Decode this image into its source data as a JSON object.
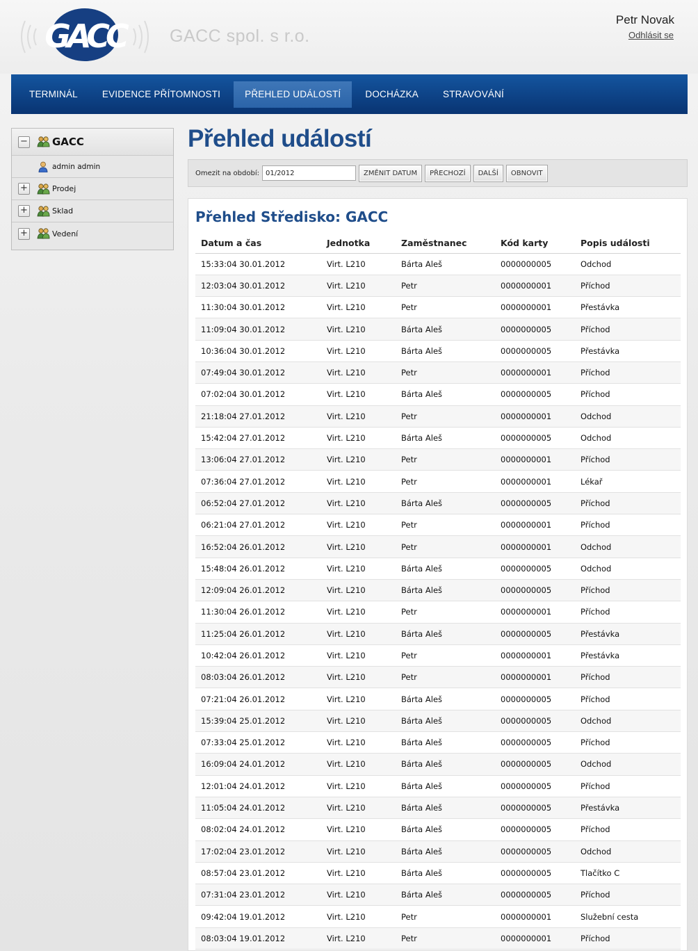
{
  "header": {
    "logo_text": "GACC",
    "company_name": "GACC spol. s r.o.",
    "user_name": "Petr Novak",
    "logout_label": "Odhlásit se"
  },
  "nav": {
    "items": [
      {
        "label": "TERMINÁL"
      },
      {
        "label": "EVIDENCE PŘÍTOMNOSTI"
      },
      {
        "label": "PŘEHLED UDÁLOSTÍ"
      },
      {
        "label": "DOCHÁZKA"
      },
      {
        "label": "STRAVOVÁNÍ"
      }
    ],
    "active_index": 2
  },
  "sidebar": {
    "root": {
      "label": "GACC",
      "toggle": "−"
    },
    "items": [
      {
        "label": "admin admin",
        "type": "user",
        "icon": "user-icon"
      },
      {
        "label": "Prodej",
        "type": "group",
        "toggle": "+",
        "icon": "group-icon"
      },
      {
        "label": "Sklad",
        "type": "group",
        "toggle": "+",
        "icon": "group-icon"
      },
      {
        "label": "Vedení",
        "type": "group",
        "toggle": "+",
        "icon": "group-icon"
      }
    ]
  },
  "main": {
    "page_title": "Přehled událostí",
    "filter": {
      "label": "Omezit na období:",
      "period_value": "01/2012",
      "buttons": {
        "change_date": "ZMĚNIT DATUM",
        "previous": "PŘECHOZÍ",
        "next": "DALŠÍ",
        "refresh": "OBNOVIT"
      }
    },
    "section_title": "Přehled Středisko: GACC",
    "table": {
      "columns": [
        "Datum a čas",
        "Jednotka",
        "Zaměstnanec",
        "Kód karty",
        "Popis události"
      ],
      "rows": [
        [
          "15:33:04 30.01.2012",
          "Virt. L210",
          "Bárta Aleš",
          "0000000005",
          "Odchod"
        ],
        [
          "12:03:04 30.01.2012",
          "Virt. L210",
          "Petr",
          "0000000001",
          "Příchod"
        ],
        [
          "11:30:04 30.01.2012",
          "Virt. L210",
          "Petr",
          "0000000001",
          "Přestávka"
        ],
        [
          "11:09:04 30.01.2012",
          "Virt. L210",
          "Bárta Aleš",
          "0000000005",
          "Příchod"
        ],
        [
          "10:36:04 30.01.2012",
          "Virt. L210",
          "Bárta Aleš",
          "0000000005",
          "Přestávka"
        ],
        [
          "07:49:04 30.01.2012",
          "Virt. L210",
          "Petr",
          "0000000001",
          "Příchod"
        ],
        [
          "07:02:04 30.01.2012",
          "Virt. L210",
          "Bárta Aleš",
          "0000000005",
          "Příchod"
        ],
        [
          "21:18:04 27.01.2012",
          "Virt. L210",
          "Petr",
          "0000000001",
          "Odchod"
        ],
        [
          "15:42:04 27.01.2012",
          "Virt. L210",
          "Bárta Aleš",
          "0000000005",
          "Odchod"
        ],
        [
          "13:06:04 27.01.2012",
          "Virt. L210",
          "Petr",
          "0000000001",
          "Příchod"
        ],
        [
          "07:36:04 27.01.2012",
          "Virt. L210",
          "Petr",
          "0000000001",
          "Lékař"
        ],
        [
          "06:52:04 27.01.2012",
          "Virt. L210",
          "Bárta Aleš",
          "0000000005",
          "Příchod"
        ],
        [
          "06:21:04 27.01.2012",
          "Virt. L210",
          "Petr",
          "0000000001",
          "Příchod"
        ],
        [
          "16:52:04 26.01.2012",
          "Virt. L210",
          "Petr",
          "0000000001",
          "Odchod"
        ],
        [
          "15:48:04 26.01.2012",
          "Virt. L210",
          "Bárta Aleš",
          "0000000005",
          "Odchod"
        ],
        [
          "12:09:04 26.01.2012",
          "Virt. L210",
          "Bárta Aleš",
          "0000000005",
          "Příchod"
        ],
        [
          "11:30:04 26.01.2012",
          "Virt. L210",
          "Petr",
          "0000000001",
          "Příchod"
        ],
        [
          "11:25:04 26.01.2012",
          "Virt. L210",
          "Bárta Aleš",
          "0000000005",
          "Přestávka"
        ],
        [
          "10:42:04 26.01.2012",
          "Virt. L210",
          "Petr",
          "0000000001",
          "Přestávka"
        ],
        [
          "08:03:04 26.01.2012",
          "Virt. L210",
          "Petr",
          "0000000001",
          "Příchod"
        ],
        [
          "07:21:04 26.01.2012",
          "Virt. L210",
          "Bárta Aleš",
          "0000000005",
          "Příchod"
        ],
        [
          "15:39:04 25.01.2012",
          "Virt. L210",
          "Bárta Aleš",
          "0000000005",
          "Odchod"
        ],
        [
          "07:33:04 25.01.2012",
          "Virt. L210",
          "Bárta Aleš",
          "0000000005",
          "Příchod"
        ],
        [
          "16:09:04 24.01.2012",
          "Virt. L210",
          "Bárta Aleš",
          "0000000005",
          "Odchod"
        ],
        [
          "12:01:04 24.01.2012",
          "Virt. L210",
          "Bárta Aleš",
          "0000000005",
          "Příchod"
        ],
        [
          "11:05:04 24.01.2012",
          "Virt. L210",
          "Bárta Aleš",
          "0000000005",
          "Přestávka"
        ],
        [
          "08:02:04 24.01.2012",
          "Virt. L210",
          "Bárta Aleš",
          "0000000005",
          "Příchod"
        ],
        [
          "17:02:04 23.01.2012",
          "Virt. L210",
          "Bárta Aleš",
          "0000000005",
          "Odchod"
        ],
        [
          "08:57:04 23.01.2012",
          "Virt. L210",
          "Bárta Aleš",
          "0000000005",
          "Tlačítko C"
        ],
        [
          "07:31:04 23.01.2012",
          "Virt. L210",
          "Bárta Aleš",
          "0000000005",
          "Příchod"
        ],
        [
          "09:42:04 19.01.2012",
          "Virt. L210",
          "Petr",
          "0000000001",
          "Služební cesta"
        ],
        [
          "08:03:04 19.01.2012",
          "Virt. L210",
          "Petr",
          "0000000001",
          "Příchod"
        ]
      ]
    }
  },
  "colors": {
    "nav_bg": "#0d4184",
    "nav_active": "#2b64a8",
    "title_blue": "#1f4d8a",
    "logo_blue": "#163f82"
  }
}
